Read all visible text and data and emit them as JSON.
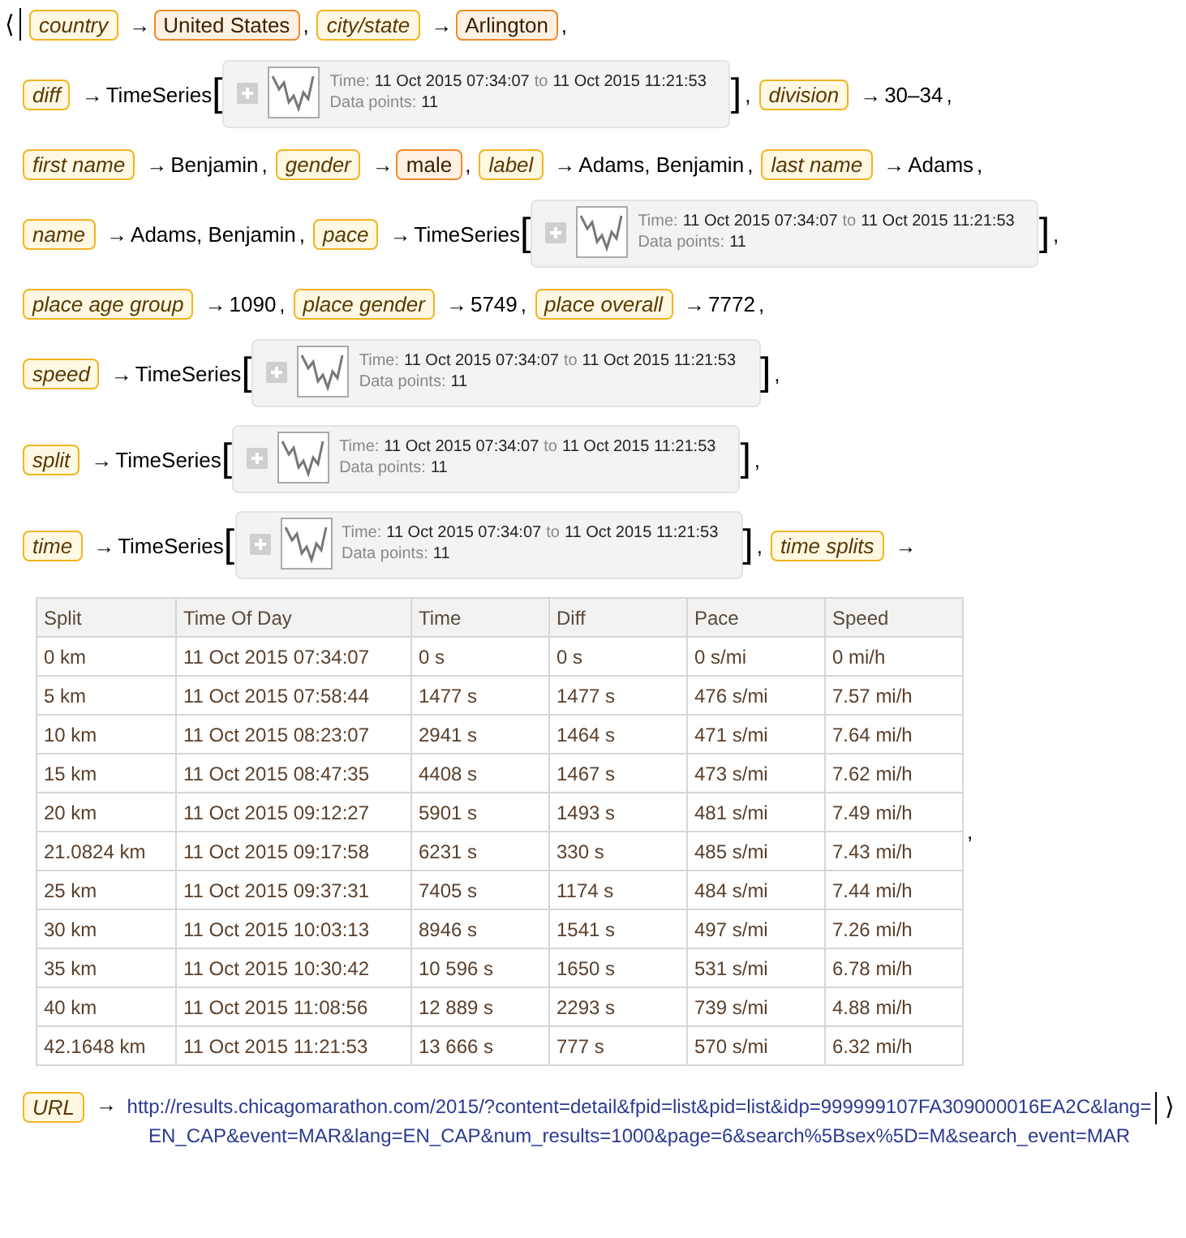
{
  "association": {
    "open": "⟨",
    "close": "⟩",
    "lines": [
      [
        {
          "key": "country",
          "arrow": "→",
          "kind": "entity",
          "value": "United States",
          "sep": ","
        },
        {
          "key": "city/state",
          "arrow": "→",
          "kind": "entity",
          "value": "Arlington",
          "sep": ","
        }
      ],
      [
        {
          "key": "diff",
          "arrow": "→",
          "kind": "timeseries",
          "head": "TimeSeries",
          "lb": "[",
          "rb": "]",
          "time_label": "Time:",
          "start": "11 Oct 2015 07:34:07",
          "to": "to",
          "end": "11 Oct 2015 11:21:53",
          "points_label": "Data points:",
          "points": "11",
          "sep": ","
        },
        {
          "key": "division",
          "arrow": "→",
          "kind": "text",
          "value": "30–34",
          "sep": ","
        }
      ],
      [
        {
          "key": "first name",
          "arrow": "→",
          "kind": "text",
          "value": "Benjamin",
          "sep": ","
        },
        {
          "key": "gender",
          "arrow": "→",
          "kind": "entity",
          "value": "male",
          "sep": ","
        },
        {
          "key": "label",
          "arrow": "→",
          "kind": "text",
          "value": "Adams, Benjamin",
          "sep": ","
        },
        {
          "key": "last name",
          "arrow": "→",
          "kind": "text",
          "value": "Adams",
          "sep": ","
        }
      ],
      [
        {
          "key": "name",
          "arrow": "→",
          "kind": "text",
          "value": "Adams, Benjamin",
          "sep": ","
        },
        {
          "key": "pace",
          "arrow": "→",
          "kind": "timeseries",
          "head": "TimeSeries",
          "lb": "[",
          "rb": "]",
          "time_label": "Time:",
          "start": "11 Oct 2015 07:34:07",
          "to": "to",
          "end": "11 Oct 2015 11:21:53",
          "points_label": "Data points:",
          "points": "11",
          "sep": ","
        }
      ],
      [
        {
          "key": "place age group",
          "arrow": "→",
          "kind": "text",
          "value": "1090",
          "sep": ","
        },
        {
          "key": "place gender",
          "arrow": "→",
          "kind": "text",
          "value": "5749",
          "sep": ","
        },
        {
          "key": "place overall",
          "arrow": "→",
          "kind": "text",
          "value": "7772",
          "sep": ","
        }
      ],
      [
        {
          "key": "speed",
          "arrow": "→",
          "kind": "timeseries",
          "head": "TimeSeries",
          "lb": "[",
          "rb": "]",
          "time_label": "Time:",
          "start": "11 Oct 2015 07:34:07",
          "to": "to",
          "end": "11 Oct 2015 11:21:53",
          "points_label": "Data points:",
          "points": "11",
          "sep": ","
        }
      ],
      [
        {
          "key": "split",
          "arrow": "→",
          "kind": "timeseries",
          "head": "TimeSeries",
          "lb": "[",
          "rb": "]",
          "time_label": "Time:",
          "start": "11 Oct 2015 07:34:07",
          "to": "to",
          "end": "11 Oct 2015 11:21:53",
          "points_label": "Data points:",
          "points": "11",
          "sep": ","
        }
      ],
      [
        {
          "key": "time",
          "arrow": "→",
          "kind": "timeseries",
          "head": "TimeSeries",
          "lb": "[",
          "rb": "]",
          "time_label": "Time:",
          "start": "11 Oct 2015 07:34:07",
          "to": "to",
          "end": "11 Oct 2015 11:21:53",
          "points_label": "Data points:",
          "points": "11",
          "sep": ","
        },
        {
          "key": "time splits",
          "arrow": "→",
          "kind": "table",
          "sep": ",",
          "columns": [
            "Split",
            "Time Of Day",
            "Time",
            "Diff",
            "Pace",
            "Speed"
          ],
          "rows": [
            [
              "0 km",
              "11 Oct 2015 07:34:07",
              "0 s",
              "0 s",
              "0 s/mi",
              "0 mi/h"
            ],
            [
              "5 km",
              "11 Oct 2015 07:58:44",
              "1477 s",
              "1477 s",
              "476 s/mi",
              "7.57 mi/h"
            ],
            [
              "10 km",
              "11 Oct 2015 08:23:07",
              "2941 s",
              "1464 s",
              "471 s/mi",
              "7.64 mi/h"
            ],
            [
              "15 km",
              "11 Oct 2015 08:47:35",
              "4408 s",
              "1467 s",
              "473 s/mi",
              "7.62 mi/h"
            ],
            [
              "20 km",
              "11 Oct 2015 09:12:27",
              "5901 s",
              "1493 s",
              "481 s/mi",
              "7.49 mi/h"
            ],
            [
              "21.0824 km",
              "11 Oct 2015 09:17:58",
              "6231 s",
              "330 s",
              "485 s/mi",
              "7.43 mi/h"
            ],
            [
              "25 km",
              "11 Oct 2015 09:37:31",
              "7405 s",
              "1174 s",
              "484 s/mi",
              "7.44 mi/h"
            ],
            [
              "30 km",
              "11 Oct 2015 10:03:13",
              "8946 s",
              "1541 s",
              "497 s/mi",
              "7.26 mi/h"
            ],
            [
              "35 km",
              "11 Oct 2015 10:30:42",
              "10 596 s",
              "1650 s",
              "531 s/mi",
              "6.78 mi/h"
            ],
            [
              "40 km",
              "11 Oct 2015 11:08:56",
              "12 889 s",
              "2293 s",
              "739 s/mi",
              "4.88 mi/h"
            ],
            [
              "42.1648 km",
              "11 Oct 2015 11:21:53",
              "13 666 s",
              "777 s",
              "570 s/mi",
              "6.32 mi/h"
            ]
          ]
        }
      ],
      [
        {
          "key": "URL",
          "arrow": "→",
          "kind": "url",
          "value": "http://results.chicagomarathon.com/2015/?content=detail&fpid=list&pid=list&idp=999999107FA309000016EA2C&lang=EN_CAP&event=MAR&lang=EN_CAP&num_results=1000&page=6&search%5Bsex%5D=M&search_event=MAR"
        }
      ]
    ]
  }
}
